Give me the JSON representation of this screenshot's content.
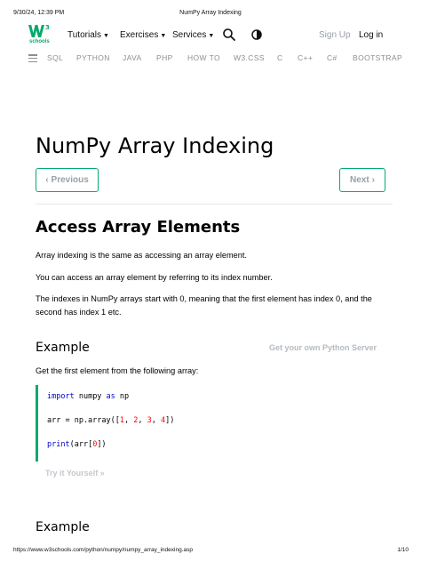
{
  "print_header": {
    "timestamp": "9/30/24, 12:39 PM",
    "page_title": "NumPy Array Indexing"
  },
  "logo": {
    "superscript": "3",
    "text": "schools"
  },
  "topnav": {
    "tutorials": "Tutorials",
    "exercises": "Exercises",
    "services": "Services",
    "signup": "Sign Up",
    "login": "Log in"
  },
  "subnav": [
    "SQL",
    "PYTHON",
    "JAVA",
    "PHP",
    "HOW TO",
    "W3.CSS",
    "C",
    "C++",
    "C#",
    "BOOTSTRAP"
  ],
  "main": {
    "title": "NumPy Array Indexing",
    "prev_label": "Previous",
    "next_label": "Next",
    "section_title": "Access Array Elements",
    "paragraphs": [
      "Array indexing is the same as accessing an array element.",
      "You can access an array element by referring to its index number.",
      "The indexes in NumPy arrays start with 0, meaning that the first element has index 0, and the second has index 1 etc."
    ],
    "example_title": "Example",
    "server_link": "Get your own Python Server",
    "example_desc": "Get the first element from the following array:",
    "code": {
      "line1_kw1": "import",
      "line1_mid": " numpy ",
      "line1_kw2": "as",
      "line1_end": " np",
      "line2_start": "arr = np.array([",
      "line2_n1": "1",
      "line2_n2": "2",
      "line2_n3": "3",
      "line2_n4": "4",
      "line2_sep": ", ",
      "line2_end": "])",
      "line3_kw": "print",
      "line3_mid": "(arr[",
      "line3_n": "0",
      "line3_end": "])"
    },
    "try_label": "Try it Yourself »",
    "example2_title": "Example"
  },
  "print_footer": {
    "url": "https://www.w3schools.com/python/numpy/numpy_array_indexing.asp",
    "page": "1/10"
  },
  "colors": {
    "brand_green": "#04AA6D",
    "keyword": "#0000cd",
    "number": "#ff0000"
  }
}
